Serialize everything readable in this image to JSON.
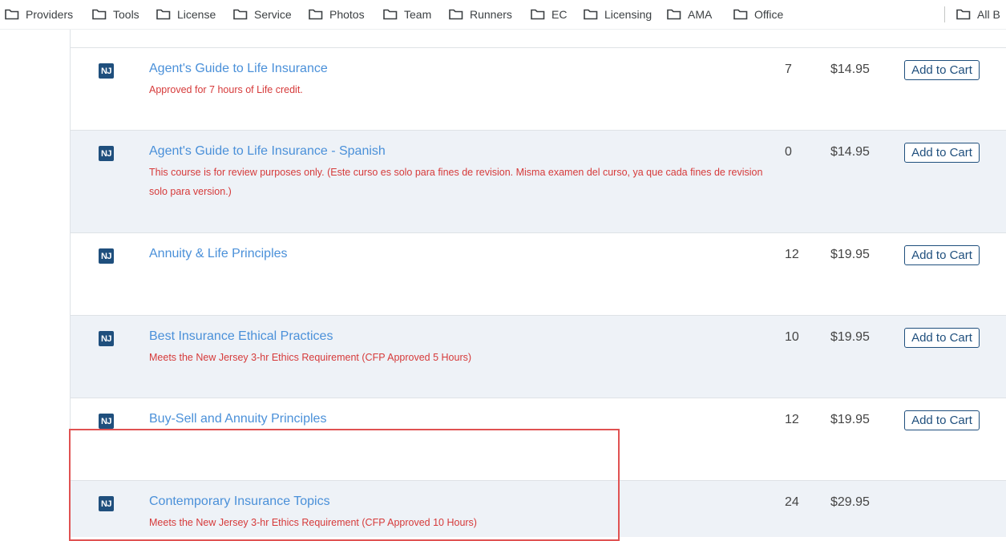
{
  "bookmarks": [
    {
      "label": "Providers",
      "icon": "folder-icon"
    },
    {
      "label": "Tools",
      "icon": "folder-icon"
    },
    {
      "label": "License",
      "icon": "folder-icon"
    },
    {
      "label": "Service",
      "icon": "folder-icon"
    },
    {
      "label": "Photos",
      "icon": "folder-icon"
    },
    {
      "label": "Team",
      "icon": "folder-icon"
    },
    {
      "label": "Runners",
      "icon": "folder-icon"
    },
    {
      "label": "EC",
      "icon": "folder-icon"
    },
    {
      "label": "Licensing",
      "icon": "folder-icon"
    },
    {
      "label": "AMA",
      "icon": "folder-icon"
    },
    {
      "label": "Office",
      "icon": "folder-icon"
    }
  ],
  "all_bookmarks": "All B",
  "courses": [
    {
      "state": "NJ",
      "title": "Agent's Guide to Life Insurance",
      "desc": "Approved for 7 hours of Life credit.",
      "hours": "7",
      "price": "$14.95",
      "cart": "Add to Cart"
    },
    {
      "state": "NJ",
      "title": "Agent's Guide to Life Insurance - Spanish",
      "desc": "This course is for review purposes only. (Este curso es solo para fines de revision. Misma examen del curso, ya que cada fines de revision solo para version.)",
      "hours": "0",
      "price": "$14.95",
      "cart": "Add to Cart"
    },
    {
      "state": "NJ",
      "title": "Annuity & Life Principles",
      "desc": "",
      "hours": "12",
      "price": "$19.95",
      "cart": "Add to Cart"
    },
    {
      "state": "NJ",
      "title": "Best Insurance Ethical Practices",
      "desc": "Meets the New Jersey 3-hr Ethics Requirement (CFP Approved 5 Hours)",
      "hours": "10",
      "price": "$19.95",
      "cart": "Add to Cart"
    },
    {
      "state": "NJ",
      "title": "Buy-Sell and Annuity Principles",
      "desc": "",
      "hours": "12",
      "price": "$19.95",
      "cart": "Add to Cart"
    },
    {
      "state": "NJ",
      "title": "Contemporary Insurance Topics",
      "desc": "Meets the New Jersey 3-hr Ethics Requirement (CFP Approved 10 Hours)",
      "hours": "24",
      "price": "$29.95",
      "cart": ""
    }
  ],
  "colors": {
    "link": "#4a90d9",
    "note": "#d63a3a",
    "badge": "#1f4f7d",
    "highlight": "#e05252"
  }
}
